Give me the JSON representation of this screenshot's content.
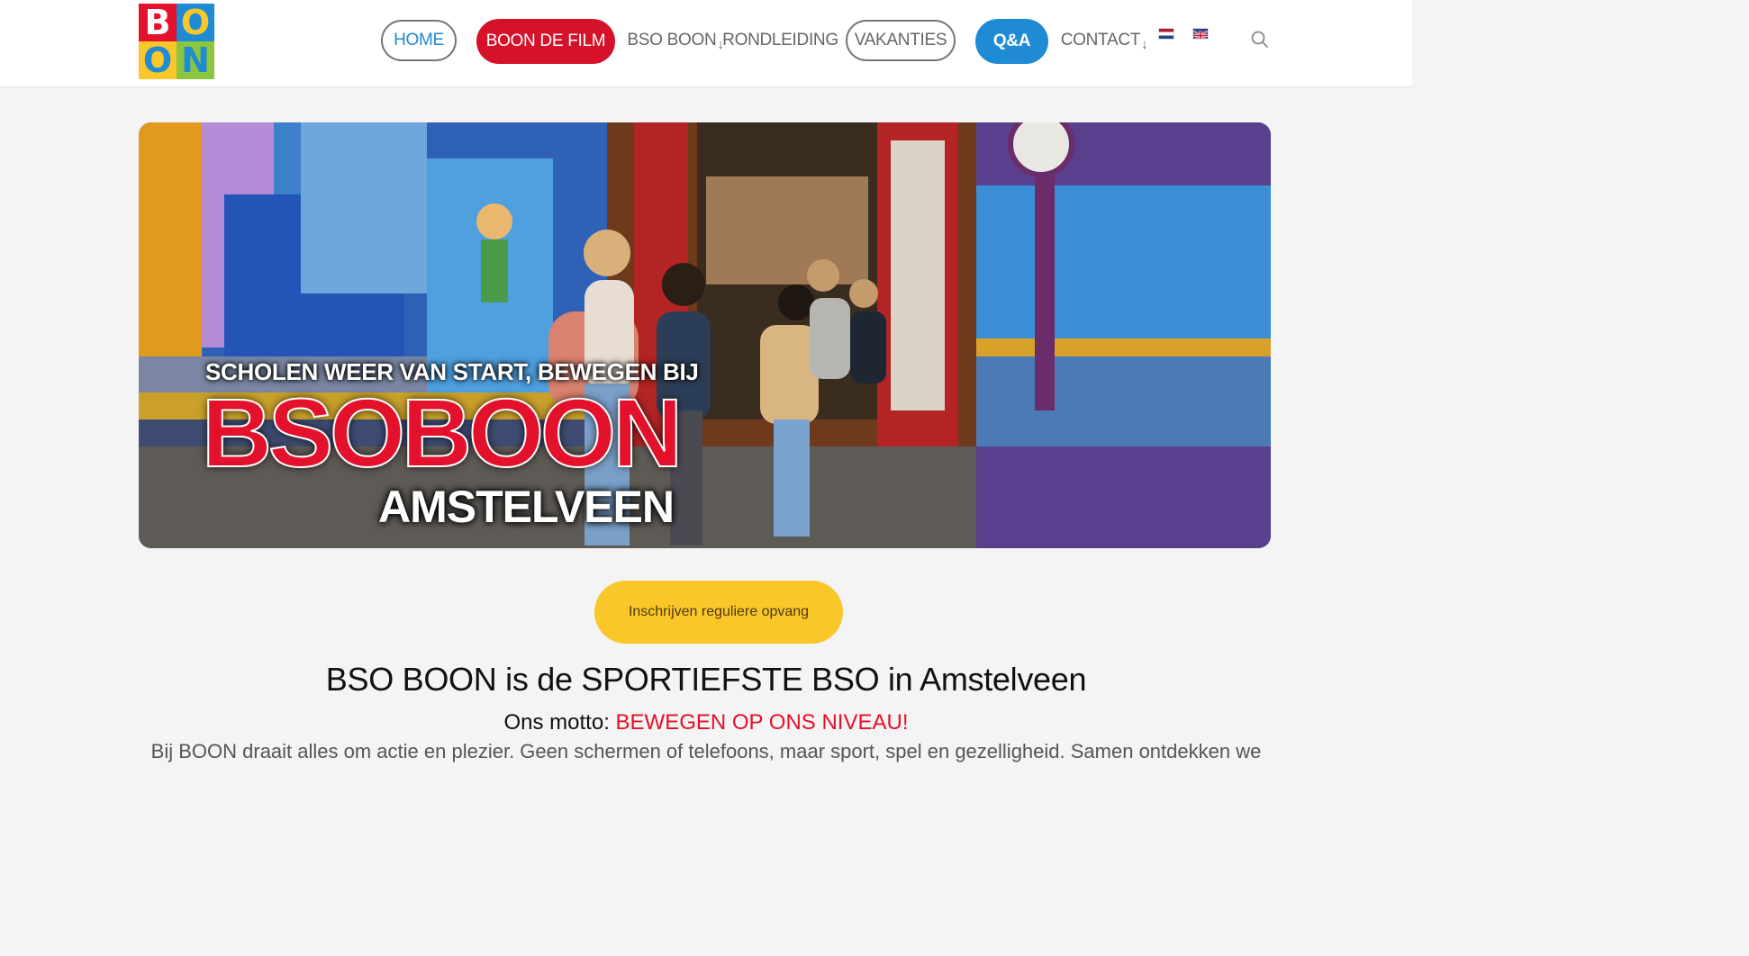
{
  "logo": {
    "letters": [
      "B",
      "O",
      "O",
      "N"
    ],
    "colors": [
      "#e3112b",
      "#1f8bd4",
      "#f9c72a",
      "#8cc63e"
    ],
    "letter_colors": [
      "#ffffff",
      "#f9c72a",
      "#1f8bd4",
      "#1f8bd4"
    ]
  },
  "nav": {
    "home": "HOME",
    "film": "BOON DE FILM",
    "bso_boon": "BSO BOON",
    "rondleiding": "RONDLEIDING",
    "vakanties": "VAKANTIES",
    "qa": "Q&A",
    "contact": "CONTACT",
    "dropdown_arrow": "↓",
    "icons": [
      "flag-nl-icon",
      "flag-en-icon",
      "search-icon"
    ]
  },
  "hero": {
    "subtitle": "SCHOLEN WEER VAN START, BEWEGEN BIJ",
    "brand": "BSOBOON",
    "city": "AMSTELVEEN"
  },
  "cta": {
    "label": "Inschrijven reguliere opvang"
  },
  "content": {
    "heading": "BSO BOON is de SPORTIEFSTE BSO in Amstelveen",
    "motto_label": "Ons motto: ",
    "motto_value": "BEWEGEN OP ONS NIVEAU!",
    "intro": "Bij BOON draait alles om actie en plezier. Geen schermen of telefoons, maar sport, spel en gezelligheid. Samen ontdekken we"
  },
  "colors": {
    "brand_red": "#d6112a",
    "brand_blue": "#1f8bd4",
    "cta_yellow": "#f9c72a"
  }
}
